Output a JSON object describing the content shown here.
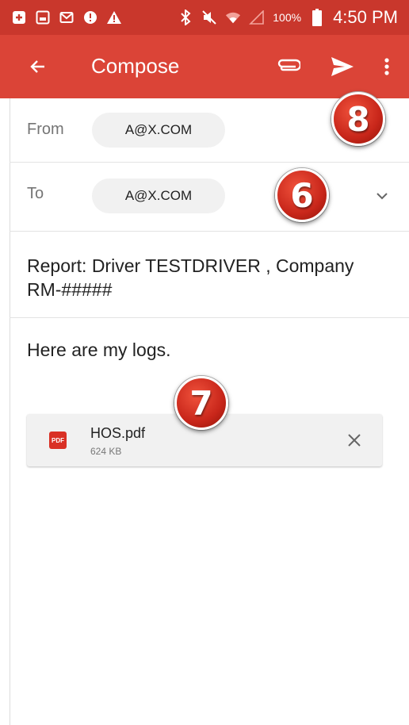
{
  "status_bar": {
    "icons": [
      "plus-box-icon",
      "image-icon",
      "gmail-icon",
      "alert-circle-icon",
      "warning-icon"
    ],
    "right_icons": [
      "bluetooth-icon",
      "mute-icon",
      "wifi-icon",
      "signal-icon"
    ],
    "battery_percent": "100%",
    "time": "4:50 PM"
  },
  "toolbar": {
    "title": "Compose",
    "color": "#db4437",
    "status_color": "#c9372c"
  },
  "from": {
    "label": "From",
    "value": "A@X.COM"
  },
  "to": {
    "label": "To",
    "value": "A@X.COM"
  },
  "subject": "Report: Driver TESTDRIVER , Company RM-#####",
  "body": "Here are my logs.",
  "attachment": {
    "icon_label": "PDF",
    "name": "HOS.pdf",
    "size": "624 KB"
  },
  "callouts": {
    "send": "8",
    "recipient": "6",
    "attachment": "7"
  }
}
